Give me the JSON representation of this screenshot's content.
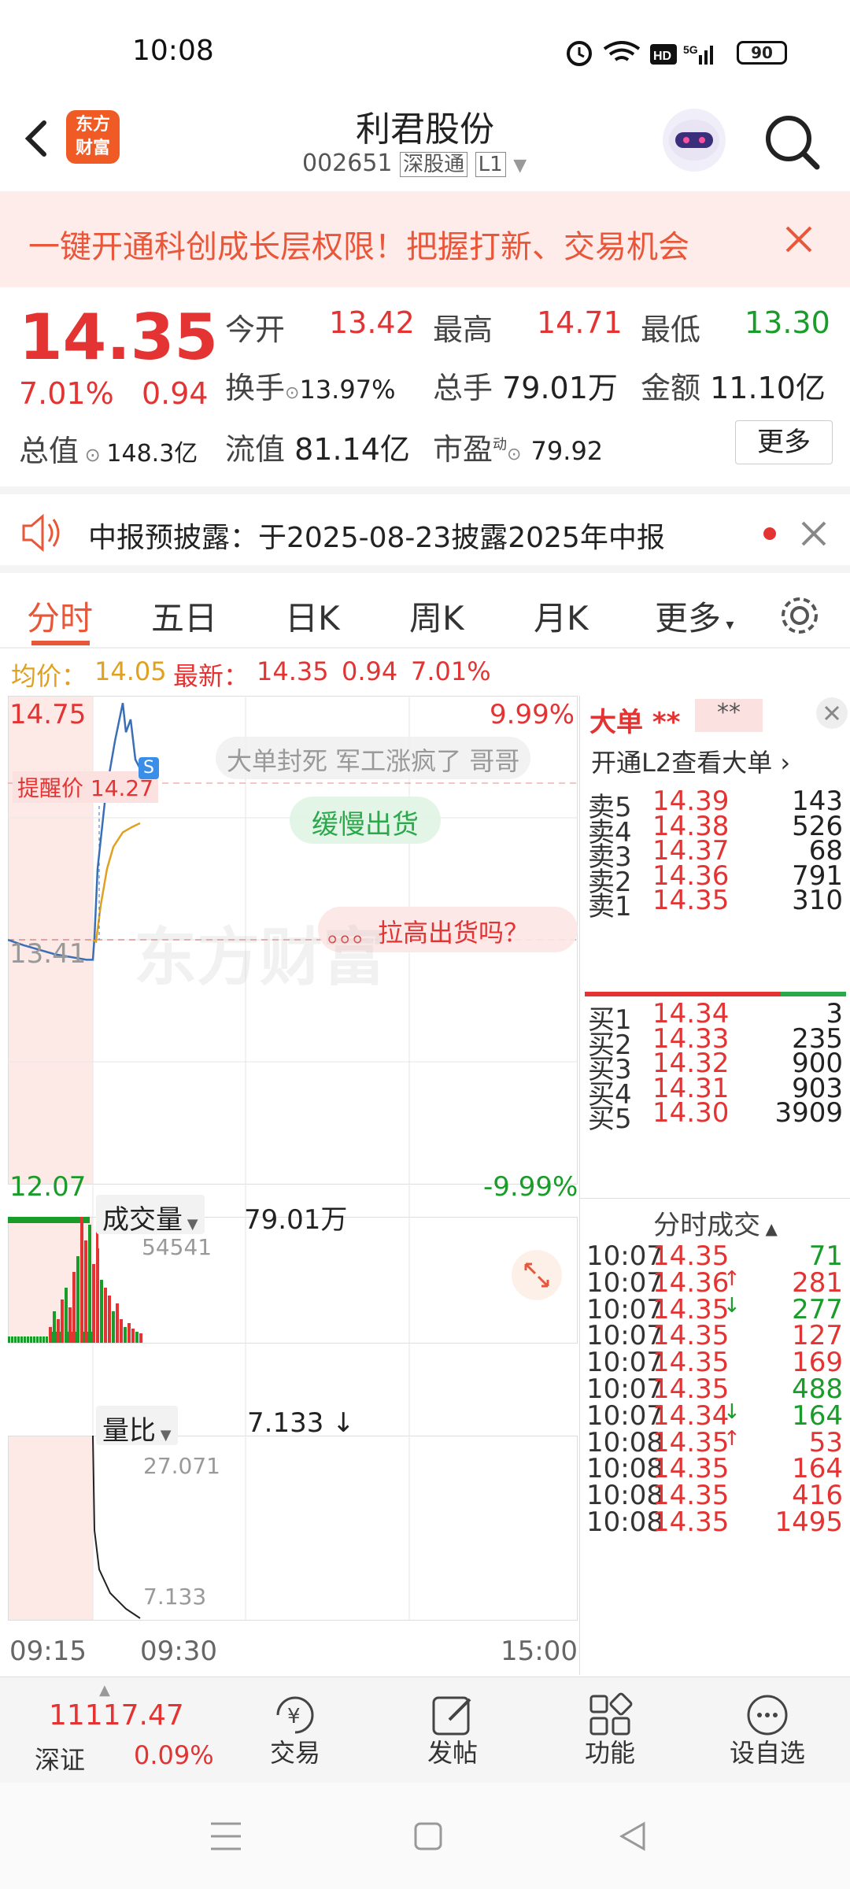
{
  "status_bar": {
    "time": "10:08",
    "battery": "90"
  },
  "header": {
    "back": "‹",
    "logo_line1": "东方",
    "logo_line2": "财富",
    "title": "利君股份",
    "code": "002651",
    "tag1": "深股通",
    "tag2": "L1"
  },
  "banner": {
    "text": "一键开通科创成长层权限！把握打新、交易机会"
  },
  "quote": {
    "price": "14.35",
    "change_pct": "7.01%",
    "change": "0.94",
    "open_label": "今开",
    "open": "13.42",
    "high_label": "最高",
    "high": "14.71",
    "low_label": "最低",
    "low": "13.30",
    "turnover_label": "换手",
    "turnover": "13.97%",
    "volume_label": "总手",
    "volume": "79.01万",
    "amount_label": "金额",
    "amount": "11.10亿",
    "mktcap_label": "总值",
    "mktcap": "148.3亿",
    "float_label": "流值",
    "float": "81.14亿",
    "pe_label": "市盈",
    "pe_sup": "动",
    "pe": "79.92",
    "more": "更多"
  },
  "notice": {
    "text": "中报预披露：于2025-08-23披露2025年中报"
  },
  "tabs": [
    "分时",
    "五日",
    "日K",
    "周K",
    "月K",
    "更多"
  ],
  "avg_line": {
    "avg_label": "均价：",
    "avg": "14.05",
    "latest_label": "最新：",
    "latest": "14.35",
    "chg": "0.94",
    "pct": "7.01%"
  },
  "chart": {
    "ymax": "14.75",
    "ymin": "12.07",
    "pmax": "9.99%",
    "pmin": "-9.99%",
    "prev_close": "13.41",
    "alert": "提醒价 14.27",
    "s_badge": "S",
    "comment1": "大单封死 军工涨疯了 哥哥",
    "comment2": "缓慢出货",
    "comment3": "。。。拉高出货吗？",
    "watermark": "东方财富",
    "vol_label": "成交量",
    "vol_value": "79.01万",
    "vol_max": "54541",
    "ratio_label": "量比",
    "ratio_value": "7.133",
    "ratio_arrow": "↓",
    "ratio_max": "27.071",
    "ratio_min": "7.133",
    "t_start": "09:15",
    "t_open": "09:30",
    "t_end": "15:00"
  },
  "chart_data": {
    "type": "line",
    "x_label_ticks": [
      "09:15",
      "09:30",
      "15:00"
    ],
    "ylim": [
      12.07,
      14.75
    ],
    "prev_close": 13.41,
    "series": [
      {
        "values": [
          13.41,
          13.38,
          13.33,
          13.3,
          13.3,
          13.3,
          13.42,
          13.8,
          14.2,
          14.5,
          14.71,
          14.55,
          14.62,
          14.4,
          14.35
        ]
      },
      {
        "values": [
          13.41,
          13.4,
          13.6,
          13.8,
          13.92,
          14.0,
          14.03,
          14.05
        ]
      }
    ]
  },
  "order_book": {
    "title": "大单",
    "stars": "**",
    "stars2": "**",
    "l2_text": "开通L2查看大单",
    "asks": [
      {
        "label": "卖5",
        "price": "14.39",
        "vol": "143"
      },
      {
        "label": "卖4",
        "price": "14.38",
        "vol": "526"
      },
      {
        "label": "卖3",
        "price": "14.37",
        "vol": "68"
      },
      {
        "label": "卖2",
        "price": "14.36",
        "vol": "791"
      },
      {
        "label": "卖1",
        "price": "14.35",
        "vol": "310"
      }
    ],
    "bids": [
      {
        "label": "买1",
        "price": "14.34",
        "vol": "3"
      },
      {
        "label": "买2",
        "price": "14.33",
        "vol": "235"
      },
      {
        "label": "买3",
        "price": "14.32",
        "vol": "900"
      },
      {
        "label": "买4",
        "price": "14.31",
        "vol": "903"
      },
      {
        "label": "买5",
        "price": "14.30",
        "vol": "3909"
      }
    ],
    "trades_title": "分时成交",
    "trades": [
      {
        "t": "10:07",
        "p": "14.35",
        "a": "",
        "v": "71",
        "c": "green"
      },
      {
        "t": "10:07",
        "p": "14.36",
        "a": "↑",
        "v": "281",
        "c": "red"
      },
      {
        "t": "10:07",
        "p": "14.35",
        "a": "↓",
        "v": "277",
        "c": "green"
      },
      {
        "t": "10:07",
        "p": "14.35",
        "a": "",
        "v": "127",
        "c": "red"
      },
      {
        "t": "10:07",
        "p": "14.35",
        "a": "",
        "v": "169",
        "c": "red"
      },
      {
        "t": "10:07",
        "p": "14.35",
        "a": "",
        "v": "488",
        "c": "green"
      },
      {
        "t": "10:07",
        "p": "14.34",
        "a": "↓",
        "v": "164",
        "c": "green"
      },
      {
        "t": "10:08",
        "p": "14.35",
        "a": "↑",
        "v": "53",
        "c": "red"
      },
      {
        "t": "10:08",
        "p": "14.35",
        "a": "",
        "v": "164",
        "c": "red"
      },
      {
        "t": "10:08",
        "p": "14.35",
        "a": "",
        "v": "416",
        "c": "red"
      },
      {
        "t": "10:08",
        "p": "14.35",
        "a": "",
        "v": "1495",
        "c": "red"
      }
    ]
  },
  "bottom_nav": {
    "index_value": "11117.47",
    "index_name": "深证",
    "index_pct": "0.09%",
    "items": [
      "交易",
      "发帖",
      "功能",
      "设自选"
    ]
  }
}
